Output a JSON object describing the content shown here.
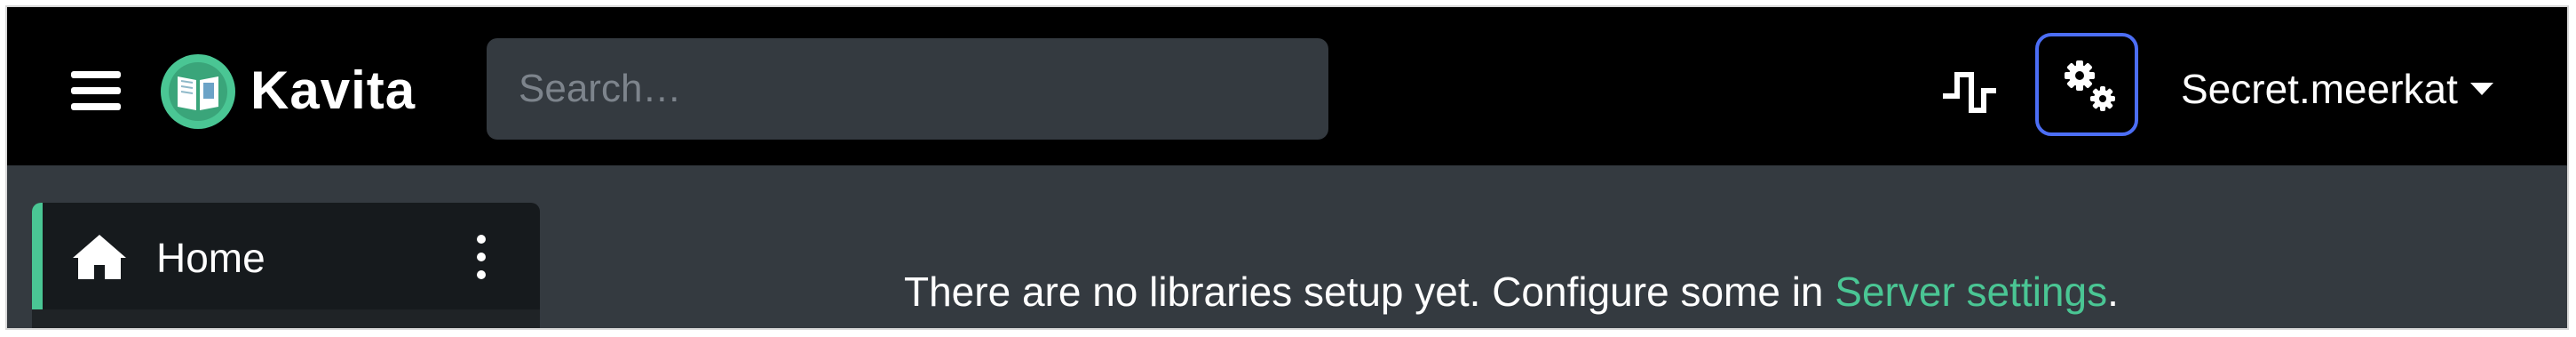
{
  "navbar": {
    "brand": "Kavita",
    "search": {
      "placeholder": "Search…",
      "value": ""
    },
    "user": {
      "name": "Secret.meerkat"
    },
    "colors": {
      "background": "#000000",
      "accent_border": "#4c6ef5"
    },
    "icons": [
      "menu-icon",
      "kavita-logo-icon",
      "activity-icon",
      "gears-icon",
      "caret-down-icon"
    ]
  },
  "sidebar": {
    "items": [
      {
        "label": "Home",
        "icon": "home-icon",
        "active": true
      }
    ],
    "colors": {
      "accent": "#4ac694",
      "item_background": "#161a1d"
    }
  },
  "main": {
    "message_prefix": "There are no libraries setup yet. Configure some in ",
    "message_link": "Server settings",
    "message_suffix": ".",
    "colors": {
      "background": "#343a40",
      "link": "#4ac694"
    }
  }
}
